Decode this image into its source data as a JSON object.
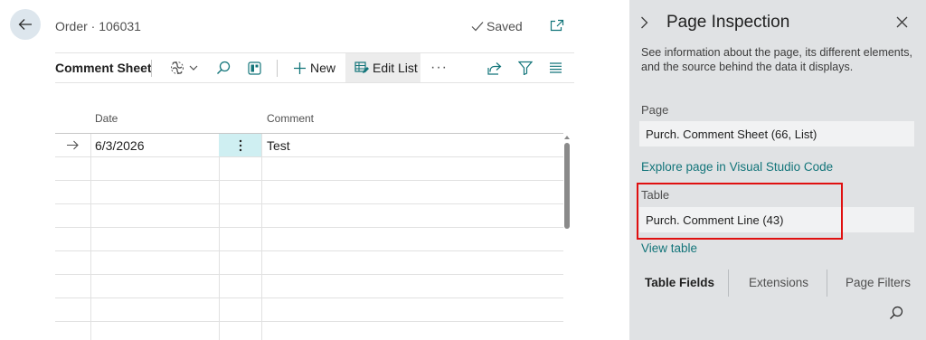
{
  "page": {
    "caption": "Order · 106031",
    "saved_label": "Saved"
  },
  "actionbar": {
    "title": "Comment Sheet",
    "new_label": "New",
    "edit_list_label": "Edit List",
    "more_label": "···"
  },
  "grid": {
    "columns": [
      "Date",
      "Comment"
    ],
    "rows": [
      {
        "date": "6/3/2026",
        "comment": "Test"
      }
    ]
  },
  "panel": {
    "title": "Page Inspection",
    "description": "See information about the page, its different elements, and the source behind the data it displays.",
    "page_label": "Page",
    "page_value": "Purch. Comment Sheet (66, List)",
    "explore_link": "Explore page in Visual Studio Code",
    "table_label": "Table",
    "table_value": "Purch. Comment Line (43)",
    "view_table_link": "View table",
    "tabs": [
      "Table Fields",
      "Extensions",
      "Page Filters"
    ]
  },
  "colors": {
    "accent": "#13757a",
    "highlight": "#e01010",
    "selected_cell": "#cfeff2",
    "panel_bg": "#e0e2e4"
  }
}
